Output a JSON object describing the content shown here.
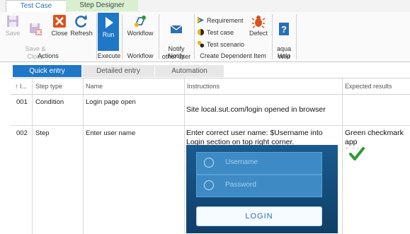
{
  "ribbon_tabs": [
    "Test Case",
    "Step Designer"
  ],
  "ribbon": {
    "save": "Save",
    "save_close": "Save &\nClose",
    "close": "Close",
    "refresh": "Refresh",
    "run": "Run",
    "workflow": "Workflow",
    "notify": "Notify\nother user",
    "requirement": "Requirement",
    "test_case": "Test case",
    "test_scenario": "Test scenario",
    "defect": "Defect",
    "aqua_wiki": "aqua\nWiki",
    "groups": {
      "actions": "Actions",
      "execute": "Execute",
      "workflow": "Workflow",
      "notify": "Notify",
      "create_dependent": "Create Dependent Item",
      "help": "Help"
    }
  },
  "grid_tabs": [
    "Quick entry",
    "Detailed entry",
    "Automation"
  ],
  "columns": [
    "↑ I...",
    "Step type",
    "Name",
    "Instructions",
    "Expected results"
  ],
  "rows": [
    {
      "id": "001",
      "type": "Condition",
      "name": "Login page open",
      "instructions": "Site local.sut.com/login opened in browser",
      "expected": ""
    },
    {
      "id": "002",
      "type": "Step",
      "name": "Enter user name",
      "instructions": "Enter correct user name:  $Username into Login section on top right corner.",
      "expected": "Green checkmark app\nfield."
    }
  ],
  "login_image": {
    "username_placeholder": "Username",
    "password_placeholder": "Password",
    "login_button": "LOGIN"
  },
  "colors": {
    "accent": "#1f77c7",
    "check": "#2e9b2e",
    "defect": "#d9531e"
  }
}
